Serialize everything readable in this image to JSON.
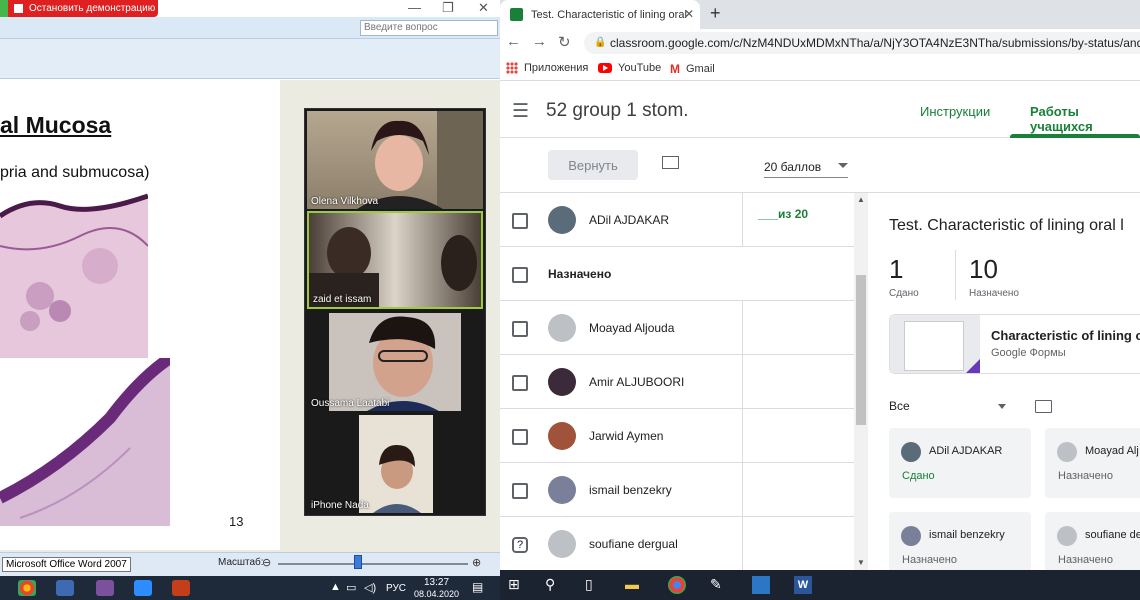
{
  "zoom_app": {
    "stop_share_label": "Остановить демонстрацию",
    "ask_placeholder": "Введите вопрос",
    "slide": {
      "title": "al Mucosa",
      "subtitle": "pria and submucosa)",
      "number": "13"
    },
    "participants": [
      {
        "name": "Olena Vilkhova"
      },
      {
        "name": "zaid et issam"
      },
      {
        "name": "Oussama Laatabi"
      },
      {
        "name": "iPhone Nada"
      }
    ],
    "status_tooltip": "Microsoft Office Word 2007",
    "zoom_label": "Масштаб:",
    "zoom_level": 0.42,
    "tray": {
      "lang": "РУС",
      "time": "13:27",
      "date": "08.04.2020"
    }
  },
  "browser": {
    "tab_title": "Test. Characteristic of lining oral",
    "url": "classroom.google.com/c/NzM4NDUxMDMxNTha/a/NjY3OTA4NzE3NTha/submissions/by-status/and-s",
    "bookmarks": [
      {
        "label": "Приложения",
        "icon": "apps-icon"
      },
      {
        "label": "YouTube",
        "icon": "youtube-icon"
      },
      {
        "label": "Gmail",
        "icon": "gmail-icon"
      }
    ]
  },
  "classroom": {
    "class_name": "52 group 1 stom.",
    "tabs": {
      "instructions": "Инструкции",
      "student_work": "Работы учащихся"
    },
    "return_label": "Вернуть",
    "points": "20 баллов",
    "students": [
      {
        "name": "ADil AJDAKAR",
        "grade": "___из 20",
        "avatar": "#5a6b7a"
      },
      {
        "section": "Назначено"
      },
      {
        "name": "Moayad Aljouda",
        "grade": "",
        "avatar": "#bdc1c6"
      },
      {
        "name": "Amir ALJUBOORI",
        "grade": "",
        "avatar": "#3a2a3a"
      },
      {
        "name": "Jarwid Aymen",
        "grade": "",
        "avatar": "#a0523a"
      },
      {
        "name": "ismail benzekry",
        "grade": "",
        "avatar": "#7a7f9a"
      },
      {
        "name": "soufiane dergual",
        "grade": "",
        "avatar": "#bdc1c6"
      }
    ],
    "detail": {
      "title": "Test. Characteristic of lining oral l",
      "turned_in": "1",
      "turned_in_label": "Сдано",
      "assigned": "10",
      "assigned_label": "Назначено",
      "attachment_title": "Characteristic of lining o",
      "attachment_sub": "Google Формы",
      "filter": "Все",
      "cards": [
        {
          "name": "ADil AJDAKAR",
          "status": "Сдано",
          "status_color": "#188038"
        },
        {
          "name": "Moayad Alj",
          "status": "Назначено",
          "status_color": "#5f6368"
        },
        {
          "name": "ismail benzekry",
          "status": "Назначено",
          "status_color": "#5f6368"
        },
        {
          "name": "soufiane de",
          "status": "Назначено",
          "status_color": "#5f6368"
        }
      ]
    }
  }
}
